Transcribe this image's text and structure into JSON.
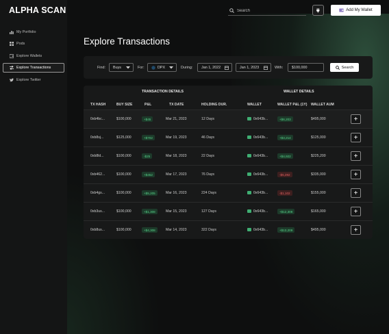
{
  "app": {
    "logo": "ALPHA SCAN"
  },
  "sidebar": {
    "items": [
      {
        "label": "My Portfolio",
        "icon": "bar-chart-icon"
      },
      {
        "label": "Pods",
        "icon": "grid-icon"
      },
      {
        "label": "Explore Wallets",
        "icon": "wallet-icon"
      },
      {
        "label": "Explore Transactions",
        "icon": "transactions-icon",
        "active": true
      },
      {
        "label": "Explore Twitter",
        "icon": "twitter-icon"
      }
    ]
  },
  "header": {
    "search_placeholder": "Search",
    "settings_icon": "plug-icon",
    "add_wallet_label": "Add My Wallet"
  },
  "page": {
    "title": "Explore Transactions"
  },
  "filters": {
    "find_label": "Find:",
    "find_value": "Buys",
    "for_label": "For:",
    "for_value": "DPX",
    "during_label": "During:",
    "start_date": "Jan 1, 2022",
    "end_date": "Jan 1, 2023",
    "with_label": "With:",
    "with_value": "$100,000",
    "search_label": "Search"
  },
  "table": {
    "group_headers": [
      "TRANSACTION DETAILS",
      "WALLET DETAILS"
    ],
    "columns": [
      "TX HASH",
      "BUY SIZE",
      "P&L",
      "TX DATE",
      "HOLDING DUR.",
      "WALLET",
      "WALLET P&L (1Y)",
      "WALLET AUM"
    ],
    "rows": [
      {
        "tx_hash": "0xb4bc...",
        "buy_size": "$100,000",
        "pnl": "+$45",
        "pnl_sign": "pos",
        "tx_date": "Mar 21, 2023",
        "holding": "12 Days",
        "wallet": "0x643b...",
        "wallet_pnl": "+$6,203",
        "wallet_pnl_sign": "pos",
        "wallet_aum": "$495,000"
      },
      {
        "tx_hash": "0xb8sj...",
        "buy_size": "$125,000",
        "pnl": "+$702",
        "pnl_sign": "pos",
        "tx_date": "Mar 19, 2023",
        "holding": "46 Days",
        "wallet": "0x643b...",
        "wallet_pnl": "+$3,214",
        "wallet_pnl_sign": "pos",
        "wallet_aum": "$125,000"
      },
      {
        "tx_hash": "0xb8ld...",
        "buy_size": "$100,000",
        "pnl": "-$25",
        "pnl_sign": "pos",
        "tx_date": "Mar 18, 2023",
        "holding": "22 Days",
        "wallet": "0x643b...",
        "wallet_pnl": "+$4,922",
        "wallet_pnl_sign": "pos",
        "wallet_aum": "$225,200"
      },
      {
        "tx_hash": "0xb462...",
        "buy_size": "$100,000",
        "pnl": "+$452",
        "pnl_sign": "pos",
        "tx_date": "Mar 17, 2023",
        "holding": "76 Days",
        "wallet": "0x643b...",
        "wallet_pnl": "-$5,392",
        "wallet_pnl_sign": "neg",
        "wallet_aum": "$335,000"
      },
      {
        "tx_hash": "0xb4gs...",
        "buy_size": "$100,000",
        "pnl": "+$5,205",
        "pnl_sign": "pos",
        "tx_date": "Mar 16, 2023",
        "holding": "224 Days",
        "wallet": "0x643b...",
        "wallet_pnl": "-$1,102",
        "wallet_pnl_sign": "neg",
        "wallet_aum": "$155,000"
      },
      {
        "tx_hash": "0xb3us...",
        "buy_size": "$100,000",
        "pnl": "+$1,308",
        "pnl_sign": "pos",
        "tx_date": "Mar 15, 2023",
        "holding": "127 Days",
        "wallet": "0x643b...",
        "wallet_pnl": "+$12,308",
        "wallet_pnl_sign": "pos",
        "wallet_aum": "$165,000"
      },
      {
        "tx_hash": "0xb8us...",
        "buy_size": "$100,000",
        "pnl": "+$4,308",
        "pnl_sign": "pos",
        "tx_date": "Mar 14, 2023",
        "holding": "322 Days",
        "wallet": "0x643b...",
        "wallet_pnl": "+$13,209",
        "wallet_pnl_sign": "pos",
        "wallet_aum": "$495,000"
      }
    ],
    "add_label": "+"
  },
  "colors": {
    "positive": "#57d48a",
    "negative": "#e06060",
    "accent_glow": "#46825f"
  }
}
